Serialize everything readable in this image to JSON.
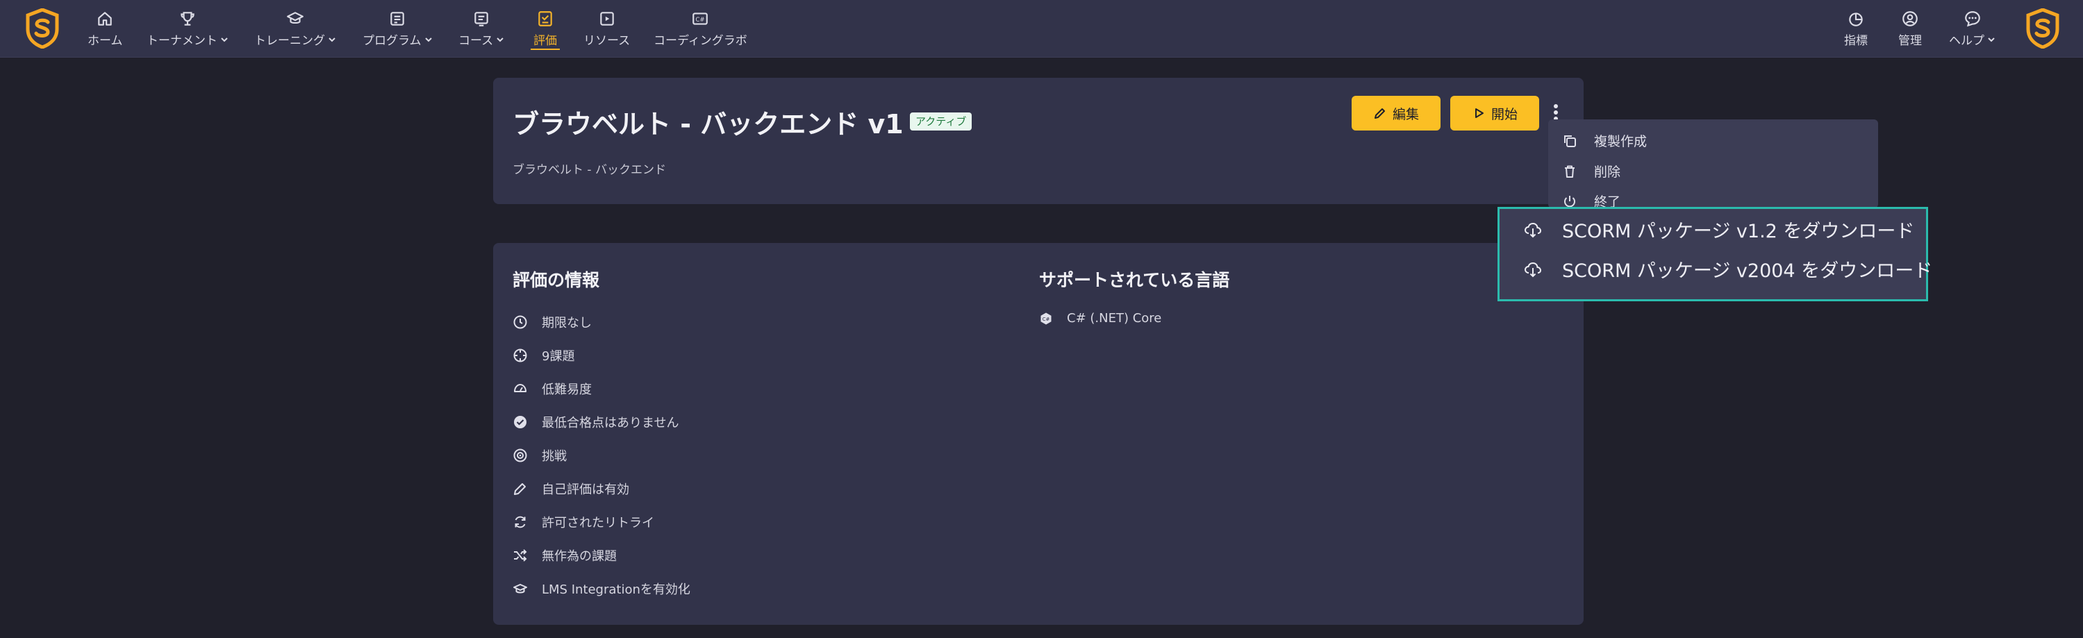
{
  "nav": {
    "items": [
      {
        "label": "ホーム",
        "icon": "home-icon",
        "dropdown": false
      },
      {
        "label": "トーナメント",
        "icon": "trophy-icon",
        "dropdown": true
      },
      {
        "label": "トレーニング",
        "icon": "graduation-cap-icon",
        "dropdown": true
      },
      {
        "label": "プログラム",
        "icon": "program-icon",
        "dropdown": true
      },
      {
        "label": "コース",
        "icon": "course-icon",
        "dropdown": true
      },
      {
        "label": "評価",
        "icon": "assessment-icon",
        "dropdown": false,
        "active": true
      },
      {
        "label": "リソース",
        "icon": "resources-icon",
        "dropdown": false
      },
      {
        "label": "コーディングラボ",
        "icon": "coding-lab-icon",
        "dropdown": false
      }
    ],
    "right_items": [
      {
        "label": "指標",
        "icon": "metrics-icon",
        "dropdown": false
      },
      {
        "label": "管理",
        "icon": "admin-icon",
        "dropdown": false
      },
      {
        "label": "ヘルプ",
        "icon": "help-icon",
        "dropdown": true
      }
    ],
    "accent_color": "#f5b42a"
  },
  "header": {
    "title": "ブラウベルト - バックエンド v1",
    "status_badge": "アクティブ",
    "subtitle": "ブラウベルト - バックエンド",
    "edit_label": "編集",
    "start_label": "開始"
  },
  "menu": {
    "items": [
      {
        "label": "複製作成",
        "icon": "copy-icon"
      },
      {
        "label": "削除",
        "icon": "trash-icon"
      },
      {
        "label": "終了",
        "icon": "power-icon"
      }
    ],
    "downloads": [
      {
        "label": "SCORM パッケージ v1.2 をダウンロード",
        "icon": "cloud-download-icon"
      },
      {
        "label": "SCORM パッケージ v2004 をダウンロード",
        "icon": "cloud-download-icon"
      }
    ]
  },
  "info": {
    "title": "評価の情報",
    "items": [
      {
        "label": "期限なし",
        "icon": "clock-icon"
      },
      {
        "label": "9課題",
        "icon": "crosshair-icon"
      },
      {
        "label": "低難易度",
        "icon": "gauge-icon"
      },
      {
        "label": "最低合格点はありません",
        "icon": "check-circle-icon"
      },
      {
        "label": "挑戦",
        "icon": "target-icon"
      },
      {
        "label": "自己評価は有効",
        "icon": "pencil-icon"
      },
      {
        "label": "許可されたリトライ",
        "icon": "refresh-icon"
      },
      {
        "label": "無作為の課題",
        "icon": "shuffle-icon"
      },
      {
        "label": "LMS Integrationを有効化",
        "icon": "lms-icon"
      }
    ]
  },
  "languages": {
    "title": "サポートされている言語",
    "items": [
      {
        "label": "C# (.NET) Core",
        "icon": "csharp-icon"
      }
    ]
  }
}
